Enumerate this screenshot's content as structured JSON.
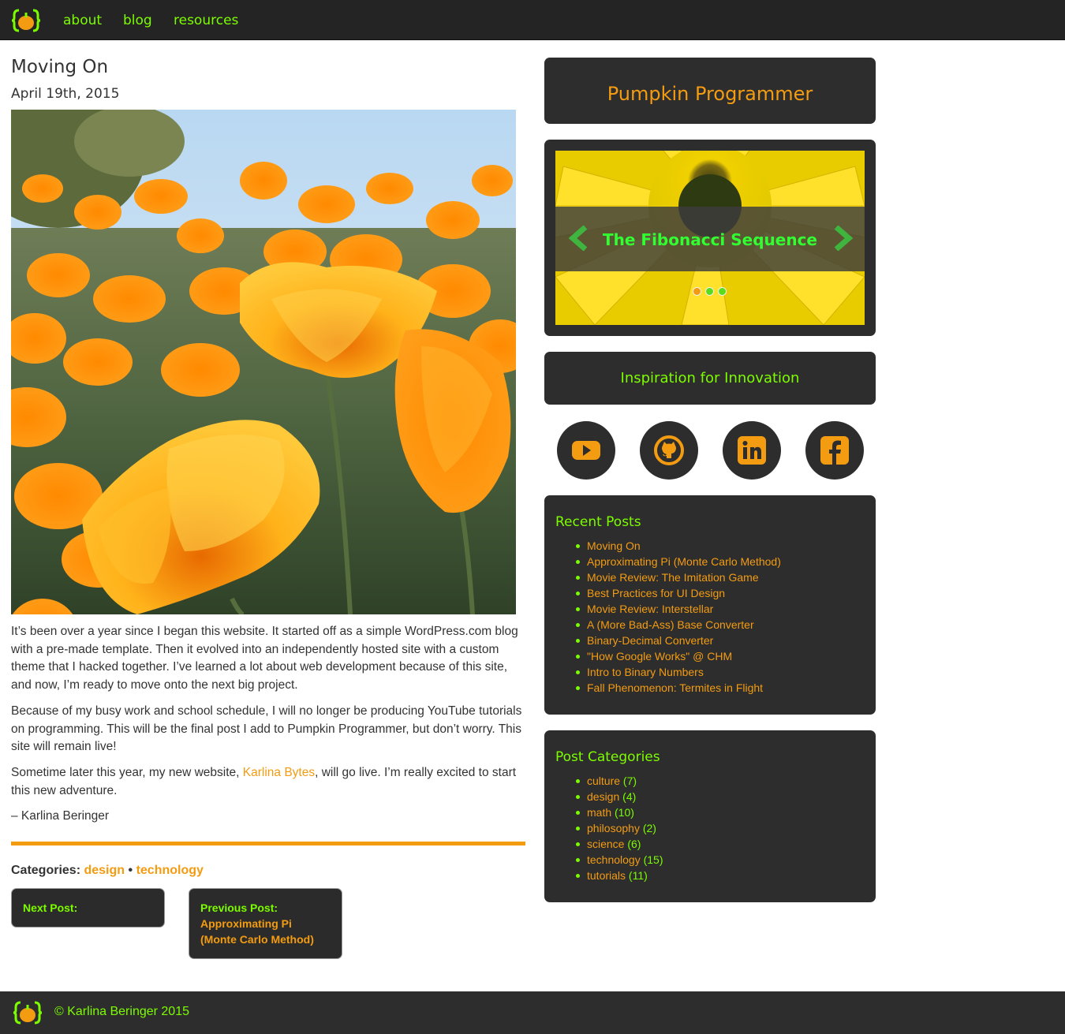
{
  "nav": {
    "links": [
      "about",
      "blog",
      "resources"
    ]
  },
  "post": {
    "title": "Moving On",
    "date": "April 19th, 2015",
    "paragraphs": [
      "It’s been over a year since I began this website. It started off as a simple WordPress.com blog with a pre-made template. Then it evolved into an independently hosted site with a custom theme that I hacked together. I’ve learned a lot about web development because of this site, and now, I’m ready to move onto the next big project.",
      "Because of my busy work and school schedule, I will no longer be producing YouTube tutorials on programming. This will be the final post I add to Pumpkin Programmer, but don’t worry. This site will remain live!"
    ],
    "p3_before": "Sometime later this year, my new website, ",
    "p3_link": "Karlina Bytes",
    "p3_after": ", will go live. I’m really excited to start this new adventure.",
    "signature": "– Karlina Beringer",
    "categories_label": "Categories:",
    "categories": [
      "design",
      "technology"
    ],
    "categories_sep": "•",
    "next_label": "Next Post:",
    "prev_label": "Previous Post:",
    "prev_title": "Approximating Pi (Monte Carlo Method)"
  },
  "sidebar": {
    "site_title": "Pumpkin Programmer",
    "slider_title": "The Fibonacci Sequence",
    "inspiration": "Inspiration for Innovation",
    "social_icons": [
      "youtube-icon",
      "github-icon",
      "linkedin-icon",
      "facebook-icon"
    ],
    "recent_title": "Recent Posts",
    "recent_posts": [
      "Moving On",
      "Approximating Pi (Monte Carlo Method)",
      "Movie Review: The Imitation Game",
      "Best Practices for UI Design",
      "Movie Review: Interstellar",
      "A (More Bad-Ass) Base Converter",
      "Binary-Decimal Converter",
      "\"How Google Works\" @ CHM",
      "Intro to Binary Numbers",
      "Fall Phenomenon: Termites in Flight"
    ],
    "categories_title": "Post Categories",
    "categories": [
      {
        "name": "culture",
        "count": "(7)"
      },
      {
        "name": "design",
        "count": "(4)"
      },
      {
        "name": "math",
        "count": "(10)"
      },
      {
        "name": "philosophy",
        "count": "(2)"
      },
      {
        "name": "science",
        "count": "(6)"
      },
      {
        "name": "technology",
        "count": "(15)"
      },
      {
        "name": "tutorials",
        "count": "(11)"
      }
    ]
  },
  "footer": {
    "copyright": "© Karlina Beringer 2015"
  },
  "colors": {
    "accent_orange": "#f39c12",
    "accent_green": "#7cfc00",
    "panel": "#2d2d2d"
  }
}
